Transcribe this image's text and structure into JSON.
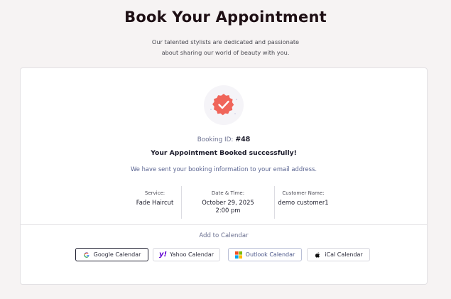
{
  "header": {
    "title": "Book Your Appointment",
    "subtitle_line1": "Our talented stylists are dedicated and passionate",
    "subtitle_line2": "about sharing our world of beauty with you."
  },
  "confirmation": {
    "booking_id_label": "Booking ID:",
    "booking_id_value": "#48",
    "success_message": "Your Appointment Booked successfully!",
    "info_message": "We have sent your booking information to your email address.",
    "badge_icon": "check-badge-icon",
    "badge_color": "#f0655a"
  },
  "details": {
    "service_label": "Service:",
    "service_value": "Fade Haircut",
    "datetime_label": "Date & Time:",
    "date_value": "October 29, 2025",
    "time_value": "2:00 pm",
    "customer_label": "Customer Name:",
    "customer_value": "demo customer1"
  },
  "calendar": {
    "heading": "Add to Calendar",
    "buttons": [
      {
        "label": "Google Calendar",
        "icon": "google-icon"
      },
      {
        "label": "Yahoo Calendar",
        "icon": "yahoo-icon"
      },
      {
        "label": "Outlook Calendar",
        "icon": "microsoft-icon"
      },
      {
        "label": "iCal Calendar",
        "icon": "apple-icon"
      }
    ]
  }
}
